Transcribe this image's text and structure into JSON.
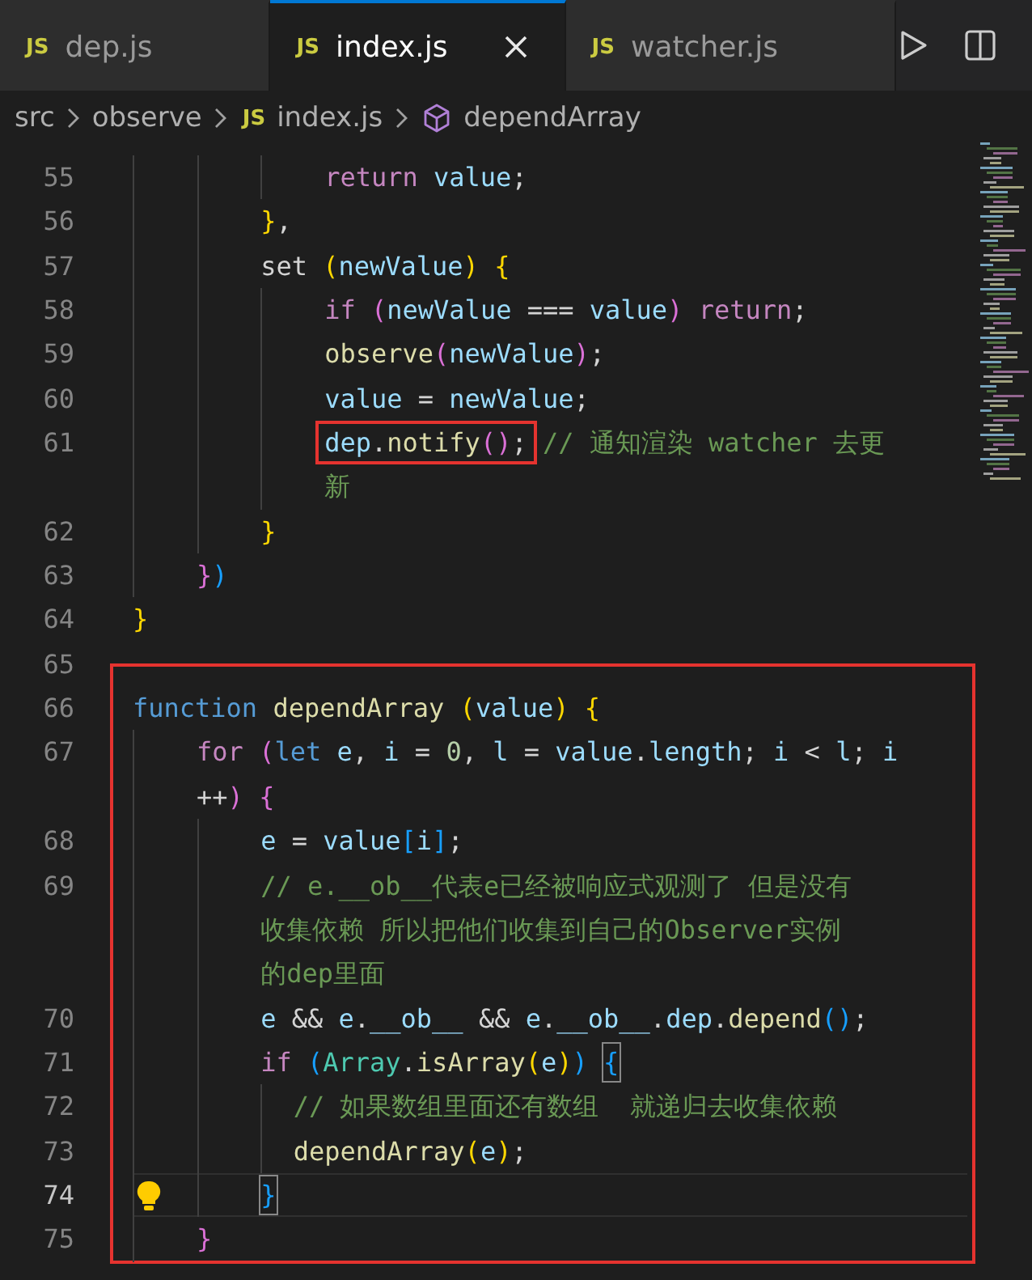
{
  "tabs": [
    {
      "file_icon": "JS",
      "label": "dep.js",
      "selected": false
    },
    {
      "file_icon": "JS",
      "label": "index.js",
      "selected": true
    },
    {
      "file_icon": "JS",
      "label": "watcher.js",
      "selected": false
    }
  ],
  "breadcrumb": [
    {
      "kind": "folder",
      "label": "src"
    },
    {
      "kind": "folder",
      "label": "observe"
    },
    {
      "kind": "file",
      "file_icon": "JS",
      "label": "index.js"
    },
    {
      "kind": "symbol",
      "label": "dependArray"
    }
  ],
  "blocks": [
    {
      "boxed": false,
      "lines": [
        {
          "number": "55",
          "rows": [
            {
              "tokens": [
                {
                  "text": "            return",
                  "kind": "kw"
                },
                {
                  "text": " value",
                  "kind": "var"
                },
                {
                  "text": ";",
                  "kind": "plain"
                }
              ]
            }
          ]
        },
        {
          "number": "56",
          "rows": [
            {
              "tokens": [
                {
                  "text": "        }",
                  "kind": "b1"
                },
                {
                  "text": ",",
                  "kind": "plain"
                }
              ]
            }
          ]
        },
        {
          "number": "57",
          "rows": [
            {
              "tokens": [
                {
                  "text": "        set ",
                  "kind": "plain"
                },
                {
                  "text": "(",
                  "kind": "b1"
                },
                {
                  "text": "newValue",
                  "kind": "var"
                },
                {
                  "text": ")",
                  "kind": "b1"
                },
                {
                  "text": " {",
                  "kind": "b1"
                }
              ]
            }
          ]
        },
        {
          "number": "58",
          "rows": [
            {
              "tokens": [
                {
                  "text": "            if ",
                  "kind": "kw"
                },
                {
                  "text": "(",
                  "kind": "b2"
                },
                {
                  "text": "newValue",
                  "kind": "var"
                },
                {
                  "text": " === ",
                  "kind": "plain"
                },
                {
                  "text": "value",
                  "kind": "var"
                },
                {
                  "text": ")",
                  "kind": "b2"
                },
                {
                  "text": " return",
                  "kind": "kw"
                },
                {
                  "text": ";",
                  "kind": "plain"
                }
              ]
            }
          ]
        },
        {
          "number": "59",
          "rows": [
            {
              "tokens": [
                {
                  "text": "            observe",
                  "kind": "fn"
                },
                {
                  "text": "(",
                  "kind": "b2"
                },
                {
                  "text": "newValue",
                  "kind": "var"
                },
                {
                  "text": ")",
                  "kind": "b2"
                },
                {
                  "text": ";",
                  "kind": "plain"
                }
              ]
            }
          ]
        },
        {
          "number": "60",
          "rows": [
            {
              "tokens": [
                {
                  "text": "            value",
                  "kind": "var"
                },
                {
                  "text": " = ",
                  "kind": "plain"
                },
                {
                  "text": "newValue",
                  "kind": "var"
                },
                {
                  "text": ";",
                  "kind": "plain"
                }
              ]
            }
          ]
        },
        {
          "number": "61",
          "rows": [
            {
              "tokens": [
                {
                  "text": "            dep",
                  "kind": "var",
                  "boxed": true
                },
                {
                  "text": ".",
                  "kind": "plain",
                  "boxed": true
                },
                {
                  "text": "notify",
                  "kind": "fn",
                  "boxed": true
                },
                {
                  "text": "()",
                  "kind": "b2",
                  "boxed": true
                },
                {
                  "text": ";",
                  "kind": "plain",
                  "boxed": true
                },
                {
                  "text": " // 通知渲染 watcher 去更",
                  "kind": "comment"
                }
              ]
            },
            {
              "tokens": [
                {
                  "text": "            新",
                  "kind": "comment"
                }
              ]
            }
          ]
        },
        {
          "number": "62",
          "rows": [
            {
              "tokens": [
                {
                  "text": "        }",
                  "kind": "b1"
                }
              ]
            }
          ]
        },
        {
          "number": "63",
          "rows": [
            {
              "tokens": [
                {
                  "text": "    }",
                  "kind": "b2"
                },
                {
                  "text": ")",
                  "kind": "b3"
                }
              ]
            }
          ]
        },
        {
          "number": "64",
          "rows": [
            {
              "tokens": [
                {
                  "text": "}",
                  "kind": "b1"
                }
              ]
            }
          ]
        },
        {
          "number": "65"
        }
      ]
    },
    {
      "boxed": true,
      "lines": [
        {
          "number": "66",
          "rows": [
            {
              "tokens": [
                {
                  "text": "function",
                  "kind": "storage"
                },
                {
                  "text": " dependArray ",
                  "kind": "fn"
                },
                {
                  "text": "(",
                  "kind": "b1"
                },
                {
                  "text": "value",
                  "kind": "var"
                },
                {
                  "text": ")",
                  "kind": "b1"
                },
                {
                  "text": " {",
                  "kind": "b1"
                }
              ]
            }
          ]
        },
        {
          "number": "67",
          "rows": [
            {
              "tokens": [
                {
                  "text": "    for ",
                  "kind": "kw"
                },
                {
                  "text": "(",
                  "kind": "b2"
                },
                {
                  "text": "let",
                  "kind": "storage"
                },
                {
                  "text": " e",
                  "kind": "var"
                },
                {
                  "text": ", ",
                  "kind": "plain"
                },
                {
                  "text": "i",
                  "kind": "var"
                },
                {
                  "text": " = ",
                  "kind": "plain"
                },
                {
                  "text": "0",
                  "kind": "num"
                },
                {
                  "text": ", ",
                  "kind": "plain"
                },
                {
                  "text": "l",
                  "kind": "var"
                },
                {
                  "text": " = ",
                  "kind": "plain"
                },
                {
                  "text": "value",
                  "kind": "var"
                },
                {
                  "text": ".",
                  "kind": "plain"
                },
                {
                  "text": "length",
                  "kind": "var"
                },
                {
                  "text": "; ",
                  "kind": "plain"
                },
                {
                  "text": "i",
                  "kind": "var"
                },
                {
                  "text": " < ",
                  "kind": "plain"
                },
                {
                  "text": "l",
                  "kind": "var"
                },
                {
                  "text": "; ",
                  "kind": "plain"
                },
                {
                  "text": "i",
                  "kind": "var"
                }
              ]
            },
            {
              "tokens": [
                {
                  "text": "    ++",
                  "kind": "plain"
                },
                {
                  "text": ")",
                  "kind": "b2"
                },
                {
                  "text": " {",
                  "kind": "b2"
                }
              ]
            }
          ]
        },
        {
          "number": "68",
          "rows": [
            {
              "tokens": [
                {
                  "text": "        e",
                  "kind": "var"
                },
                {
                  "text": " = ",
                  "kind": "plain"
                },
                {
                  "text": "value",
                  "kind": "var"
                },
                {
                  "text": "[",
                  "kind": "b3"
                },
                {
                  "text": "i",
                  "kind": "var"
                },
                {
                  "text": "]",
                  "kind": "b3"
                },
                {
                  "text": ";",
                  "kind": "plain"
                }
              ]
            }
          ]
        },
        {
          "number": "69",
          "rows": [
            {
              "tokens": [
                {
                  "text": "        // e.__ob__代表e已经被响应式观测了 但是没有",
                  "kind": "comment"
                }
              ]
            },
            {
              "tokens": [
                {
                  "text": "        收集依赖 所以把他们收集到自己的Observer实例",
                  "kind": "comment"
                }
              ]
            },
            {
              "tokens": [
                {
                  "text": "        的dep里面",
                  "kind": "comment"
                }
              ]
            }
          ]
        },
        {
          "number": "70",
          "rows": [
            {
              "tokens": [
                {
                  "text": "        e",
                  "kind": "var"
                },
                {
                  "text": " && ",
                  "kind": "plain"
                },
                {
                  "text": "e",
                  "kind": "var"
                },
                {
                  "text": ".",
                  "kind": "plain"
                },
                {
                  "text": "__ob__",
                  "kind": "var"
                },
                {
                  "text": " && ",
                  "kind": "plain"
                },
                {
                  "text": "e",
                  "kind": "var"
                },
                {
                  "text": ".",
                  "kind": "plain"
                },
                {
                  "text": "__ob__",
                  "kind": "var"
                },
                {
                  "text": ".",
                  "kind": "plain"
                },
                {
                  "text": "dep",
                  "kind": "var"
                },
                {
                  "text": ".",
                  "kind": "plain"
                },
                {
                  "text": "depend",
                  "kind": "fn"
                },
                {
                  "text": "()",
                  "kind": "b3"
                },
                {
                  "text": ";",
                  "kind": "plain"
                }
              ]
            }
          ]
        },
        {
          "number": "71",
          "rows": [
            {
              "tokens": [
                {
                  "text": "        if ",
                  "kind": "kw"
                },
                {
                  "text": "(",
                  "kind": "b3"
                },
                {
                  "text": "Array",
                  "kind": "type"
                },
                {
                  "text": ".",
                  "kind": "plain"
                },
                {
                  "text": "isArray",
                  "kind": "fn"
                },
                {
                  "text": "(",
                  "kind": "b1"
                },
                {
                  "text": "e",
                  "kind": "var"
                },
                {
                  "text": ")",
                  "kind": "b1"
                },
                {
                  "text": ") ",
                  "kind": "b3"
                },
                {
                  "text": "{",
                  "kind": "b3",
                  "matched": true
                }
              ]
            }
          ]
        },
        {
          "number": "72",
          "rows": [
            {
              "tokens": [
                {
                  "text": "          // 如果数组里面还有数组  就递归去收集依赖",
                  "kind": "comment"
                }
              ]
            }
          ]
        },
        {
          "number": "73",
          "rows": [
            {
              "tokens": [
                {
                  "text": "          dependArray",
                  "kind": "fn"
                },
                {
                  "text": "(",
                  "kind": "b1"
                },
                {
                  "text": "e",
                  "kind": "var"
                },
                {
                  "text": ")",
                  "kind": "b1"
                },
                {
                  "text": ";",
                  "kind": "plain"
                }
              ]
            }
          ]
        },
        {
          "number": "74",
          "current": true,
          "rows": [
            {
              "tokens": [
                {
                  "text": "        }",
                  "kind": "b3",
                  "matched": true
                }
              ]
            }
          ]
        },
        {
          "number": "75",
          "rows": [
            {
              "tokens": [
                {
                  "text": "    }",
                  "kind": "b2"
                }
              ]
            }
          ]
        }
      ]
    }
  ]
}
